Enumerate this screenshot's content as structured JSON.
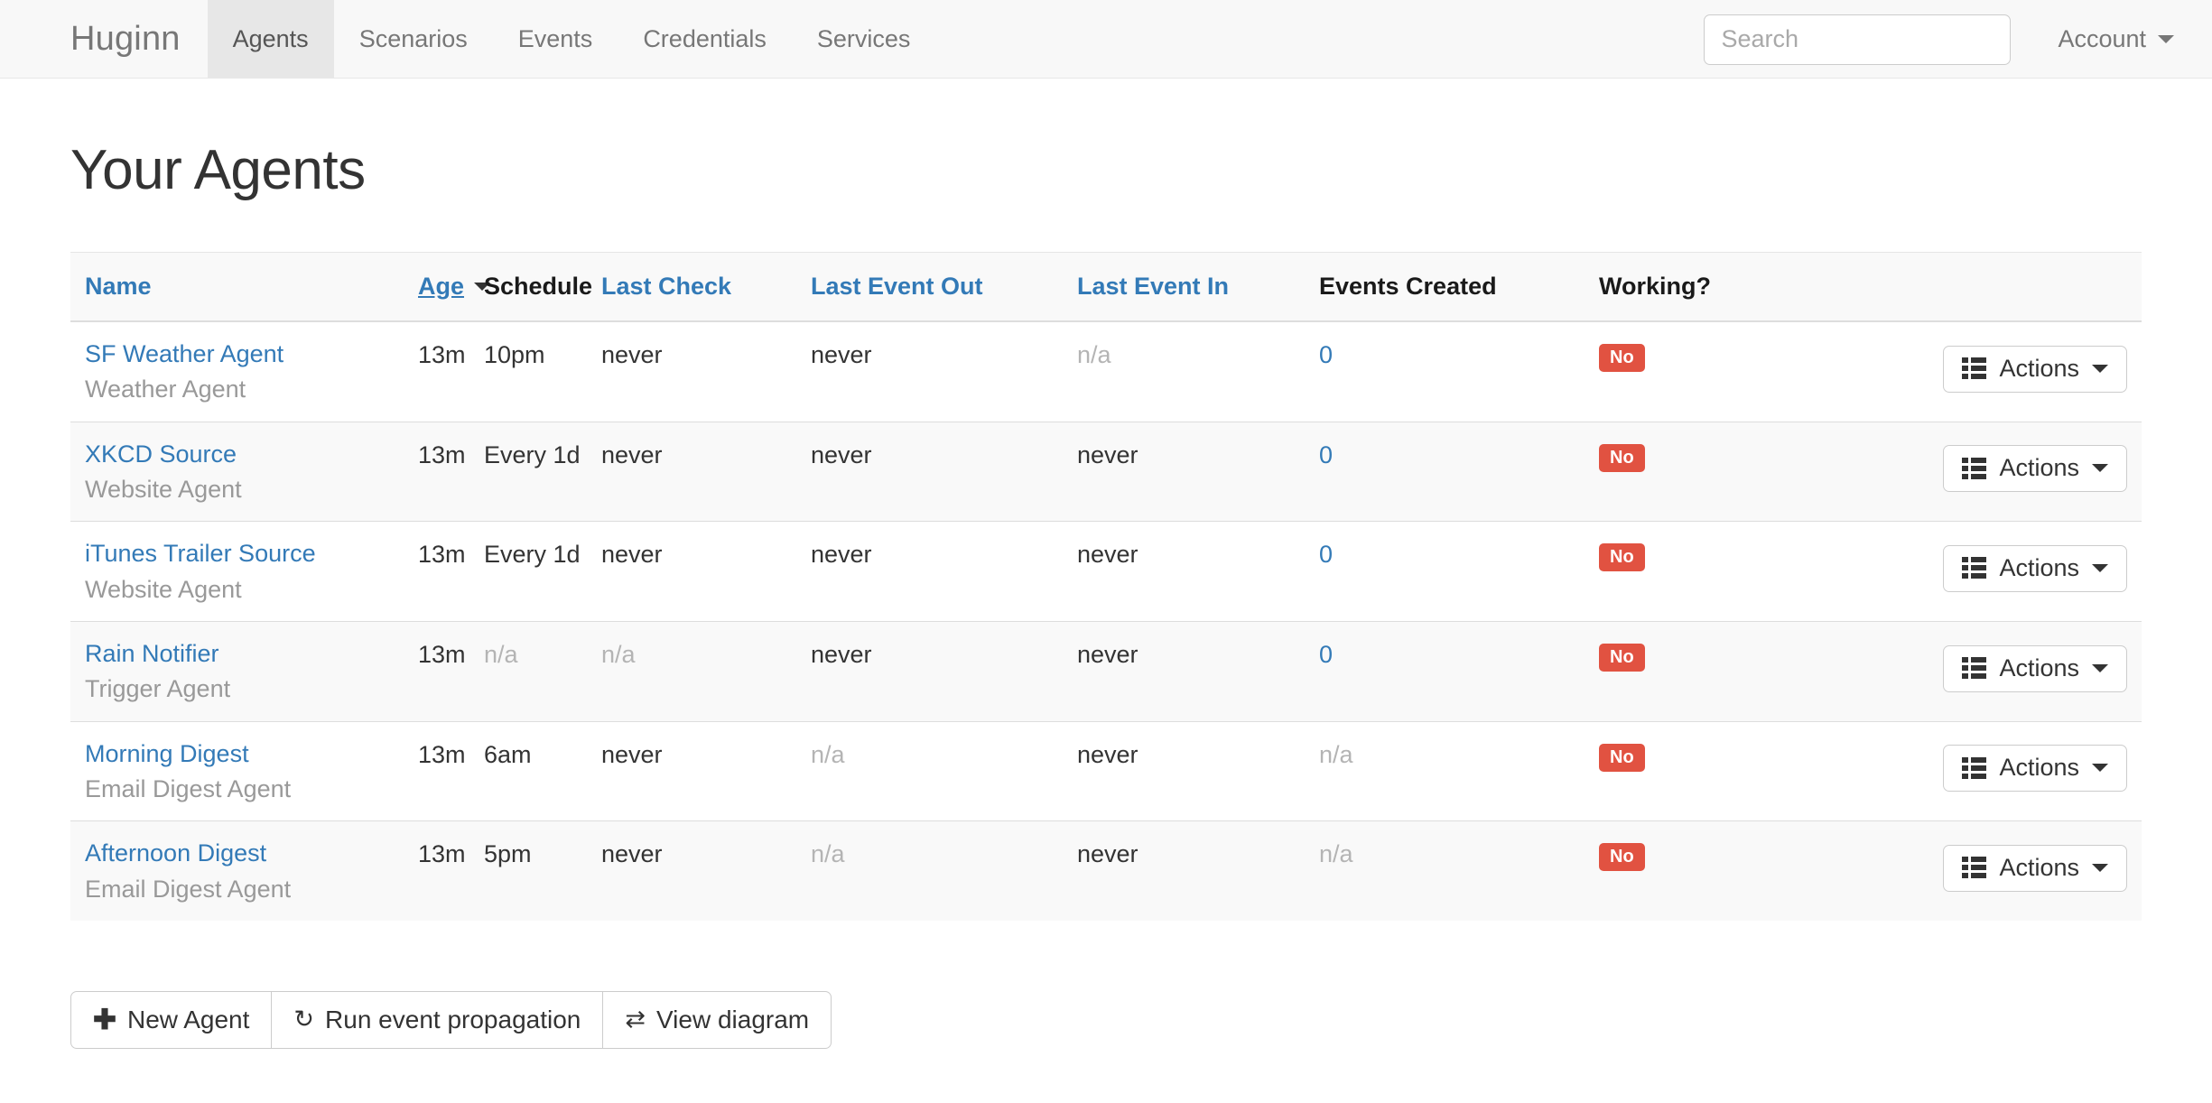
{
  "navbar": {
    "brand": "Huginn",
    "items": [
      {
        "label": "Agents",
        "active": true
      },
      {
        "label": "Scenarios",
        "active": false
      },
      {
        "label": "Events",
        "active": false
      },
      {
        "label": "Credentials",
        "active": false
      },
      {
        "label": "Services",
        "active": false
      }
    ],
    "search": {
      "placeholder": "Search",
      "value": ""
    },
    "account": {
      "label": "Account",
      "icon": "chevron-down-icon"
    }
  },
  "page": {
    "title": "Your Agents"
  },
  "table": {
    "headers": [
      {
        "label": "Name",
        "link": true,
        "sorted": false
      },
      {
        "label": "Age",
        "link": true,
        "sorted": true
      },
      {
        "label": "Schedule",
        "link": false,
        "sorted": false
      },
      {
        "label": "Last Check",
        "link": true,
        "sorted": false
      },
      {
        "label": "Last Event Out",
        "link": true,
        "sorted": false
      },
      {
        "label": "Last Event In",
        "link": true,
        "sorted": false
      },
      {
        "label": "Events Created",
        "link": false,
        "sorted": false
      },
      {
        "label": "Working?",
        "link": false,
        "sorted": false
      },
      {
        "label": "",
        "link": false,
        "sorted": false
      }
    ],
    "sort_caret_icon": "caret-down-icon",
    "actions_label": "Actions",
    "actions_icon": "th-list-icon",
    "actions_caret_icon": "caret-down-icon",
    "rows": [
      {
        "name": "SF Weather Agent",
        "type": "Weather Agent",
        "age": "13m",
        "schedule": "10pm",
        "schedule_muted": false,
        "last_check": "never",
        "last_check_muted": false,
        "last_event_out": "never",
        "last_event_out_muted": false,
        "last_event_in": "n/a",
        "last_event_in_muted": true,
        "events_created": "0",
        "events_created_muted": false,
        "working": "No"
      },
      {
        "name": "XKCD Source",
        "type": "Website Agent",
        "age": "13m",
        "schedule": "Every 1d",
        "schedule_muted": false,
        "last_check": "never",
        "last_check_muted": false,
        "last_event_out": "never",
        "last_event_out_muted": false,
        "last_event_in": "never",
        "last_event_in_muted": false,
        "events_created": "0",
        "events_created_muted": false,
        "working": "No"
      },
      {
        "name": "iTunes Trailer Source",
        "type": "Website Agent",
        "age": "13m",
        "schedule": "Every 1d",
        "schedule_muted": false,
        "last_check": "never",
        "last_check_muted": false,
        "last_event_out": "never",
        "last_event_out_muted": false,
        "last_event_in": "never",
        "last_event_in_muted": false,
        "events_created": "0",
        "events_created_muted": false,
        "working": "No"
      },
      {
        "name": "Rain Notifier",
        "type": "Trigger Agent",
        "age": "13m",
        "schedule": "n/a",
        "schedule_muted": true,
        "last_check": "n/a",
        "last_check_muted": true,
        "last_event_out": "never",
        "last_event_out_muted": false,
        "last_event_in": "never",
        "last_event_in_muted": false,
        "events_created": "0",
        "events_created_muted": false,
        "working": "No"
      },
      {
        "name": "Morning Digest",
        "type": "Email Digest Agent",
        "age": "13m",
        "schedule": "6am",
        "schedule_muted": false,
        "last_check": "never",
        "last_check_muted": false,
        "last_event_out": "n/a",
        "last_event_out_muted": true,
        "last_event_in": "never",
        "last_event_in_muted": false,
        "events_created": "n/a",
        "events_created_muted": true,
        "working": "No"
      },
      {
        "name": "Afternoon Digest",
        "type": "Email Digest Agent",
        "age": "13m",
        "schedule": "5pm",
        "schedule_muted": false,
        "last_check": "never",
        "last_check_muted": false,
        "last_event_out": "n/a",
        "last_event_out_muted": true,
        "last_event_in": "never",
        "last_event_in_muted": false,
        "events_created": "n/a",
        "events_created_muted": true,
        "working": "No"
      }
    ]
  },
  "footer_buttons": [
    {
      "label": "New Agent",
      "icon": "plus-icon",
      "glyph": "✚"
    },
    {
      "label": "Run event propagation",
      "icon": "refresh-icon",
      "glyph": "↻"
    },
    {
      "label": "View diagram",
      "icon": "shuffle-icon",
      "glyph": "⇄"
    }
  ],
  "colors": {
    "link": "#337ab7",
    "badge_danger": "#e15241",
    "navbar_bg": "#f8f8f8",
    "stripe": "#f9f9f9",
    "muted": "#b4b4b4"
  }
}
